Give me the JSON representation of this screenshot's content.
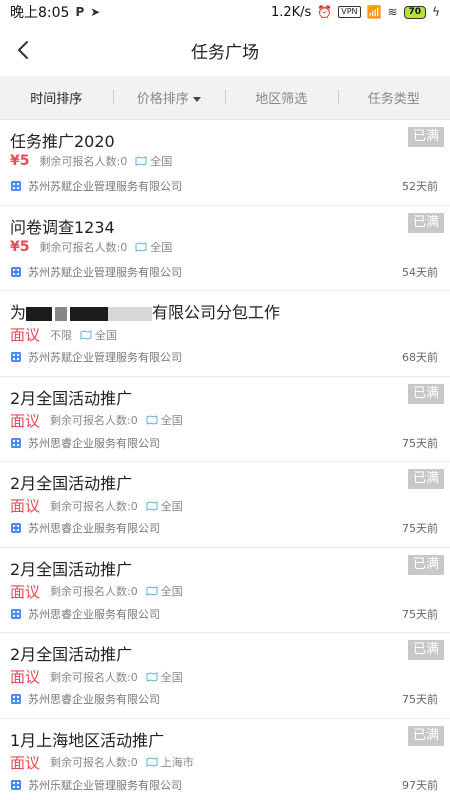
{
  "status_bar": {
    "time": "晚上8:05",
    "net_speed": "1.2K/s",
    "vpn": "VPN",
    "battery": "70"
  },
  "nav": {
    "title": "任务广场"
  },
  "filters": [
    {
      "label": "时间排序",
      "active": true
    },
    {
      "label": "价格排序",
      "active": false,
      "dropdown": true
    },
    {
      "label": "地区筛选",
      "active": false
    },
    {
      "label": "任务类型",
      "active": false
    }
  ],
  "tasks": [
    {
      "title": "任务推广2020",
      "price": "¥5",
      "quota": "剩余可报名人数:0",
      "region": "全国",
      "company": "苏州苏赋企业管理服务有限公司",
      "age": "52天前",
      "status": "已满"
    },
    {
      "title": "问卷调查1234",
      "price": "¥5",
      "quota": "剩余可报名人数:0",
      "region": "全国",
      "company": "苏州苏赋企业管理服务有限公司",
      "age": "54天前",
      "status": "已满"
    },
    {
      "title_prefix": "为",
      "title_suffix": "有限公司分包工作",
      "price": "面议",
      "quota": "不限",
      "region": "全国",
      "company": "苏州苏赋企业管理服务有限公司",
      "age": "68天前",
      "status": ""
    },
    {
      "title": "2月全国活动推广",
      "price": "面议",
      "quota": "剩余可报名人数:0",
      "region": "全国",
      "company": "苏州思睿企业服务有限公司",
      "age": "75天前",
      "status": "已满"
    },
    {
      "title": "2月全国活动推广",
      "price": "面议",
      "quota": "剩余可报名人数:0",
      "region": "全国",
      "company": "苏州思睿企业服务有限公司",
      "age": "75天前",
      "status": "已满"
    },
    {
      "title": "2月全国活动推广",
      "price": "面议",
      "quota": "剩余可报名人数:0",
      "region": "全国",
      "company": "苏州思睿企业服务有限公司",
      "age": "75天前",
      "status": "已满"
    },
    {
      "title": "2月全国活动推广",
      "price": "面议",
      "quota": "剩余可报名人数:0",
      "region": "全国",
      "company": "苏州思睿企业服务有限公司",
      "age": "75天前",
      "status": "已满"
    },
    {
      "title": "1月上海地区活动推广",
      "price": "面议",
      "quota": "剩余可报名人数:0",
      "region": "上海市",
      "company": "苏州乐赋企业管理服务有限公司",
      "age": "97天前",
      "status": "已满"
    }
  ],
  "colors": {
    "price_red": "#e84a55",
    "badge_grey": "#c8c8c8",
    "company_icon_blue": "#4a8cf0",
    "region_icon_teal": "#5fb0d8"
  }
}
